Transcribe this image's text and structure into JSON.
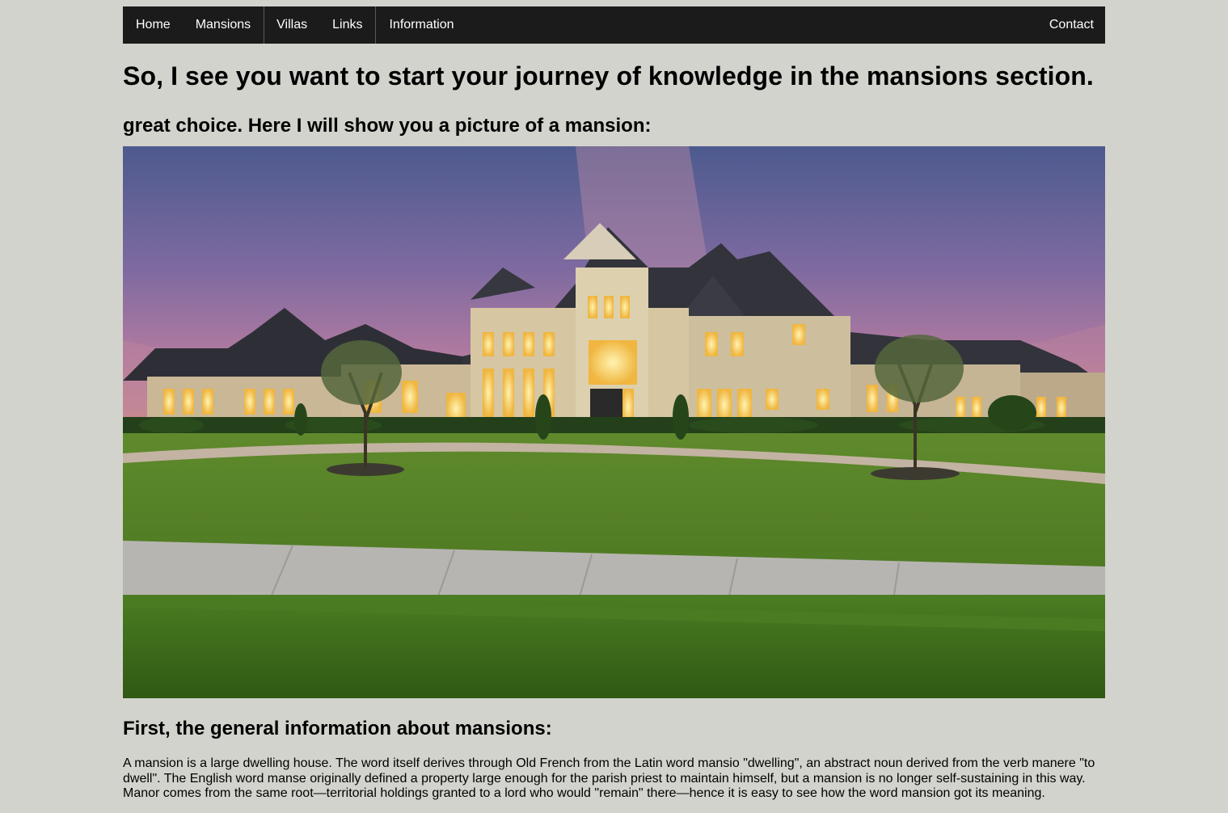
{
  "nav": {
    "items": [
      {
        "label": "Home"
      },
      {
        "label": "Mansions"
      },
      {
        "label": "Villas"
      },
      {
        "label": "Links"
      },
      {
        "label": "Information"
      }
    ],
    "contact": "Contact"
  },
  "main": {
    "title": "So, I see you want to start your journey of knowledge in the mansions section.",
    "subtitle": "great choice. Here I will show you a picture of a mansion:",
    "section_heading": "First, the general information about mansions:",
    "paragraph": "A mansion is a large dwelling house. The word itself derives through Old French from the Latin word mansio \"dwelling\", an abstract noun derived from the verb manere \"to dwell\". The English word manse originally defined a property large enough for the parish priest to maintain himself, but a mansion is no longer self-sustaining in this way. Manor comes from the same root—territorial holdings granted to a lord who would \"remain\" there—hence it is easy to see how the word mansion got its meaning."
  },
  "colors": {
    "background": "#d3d3cd",
    "nav_background": "#1b1b1b",
    "nav_text": "#ffffff"
  }
}
